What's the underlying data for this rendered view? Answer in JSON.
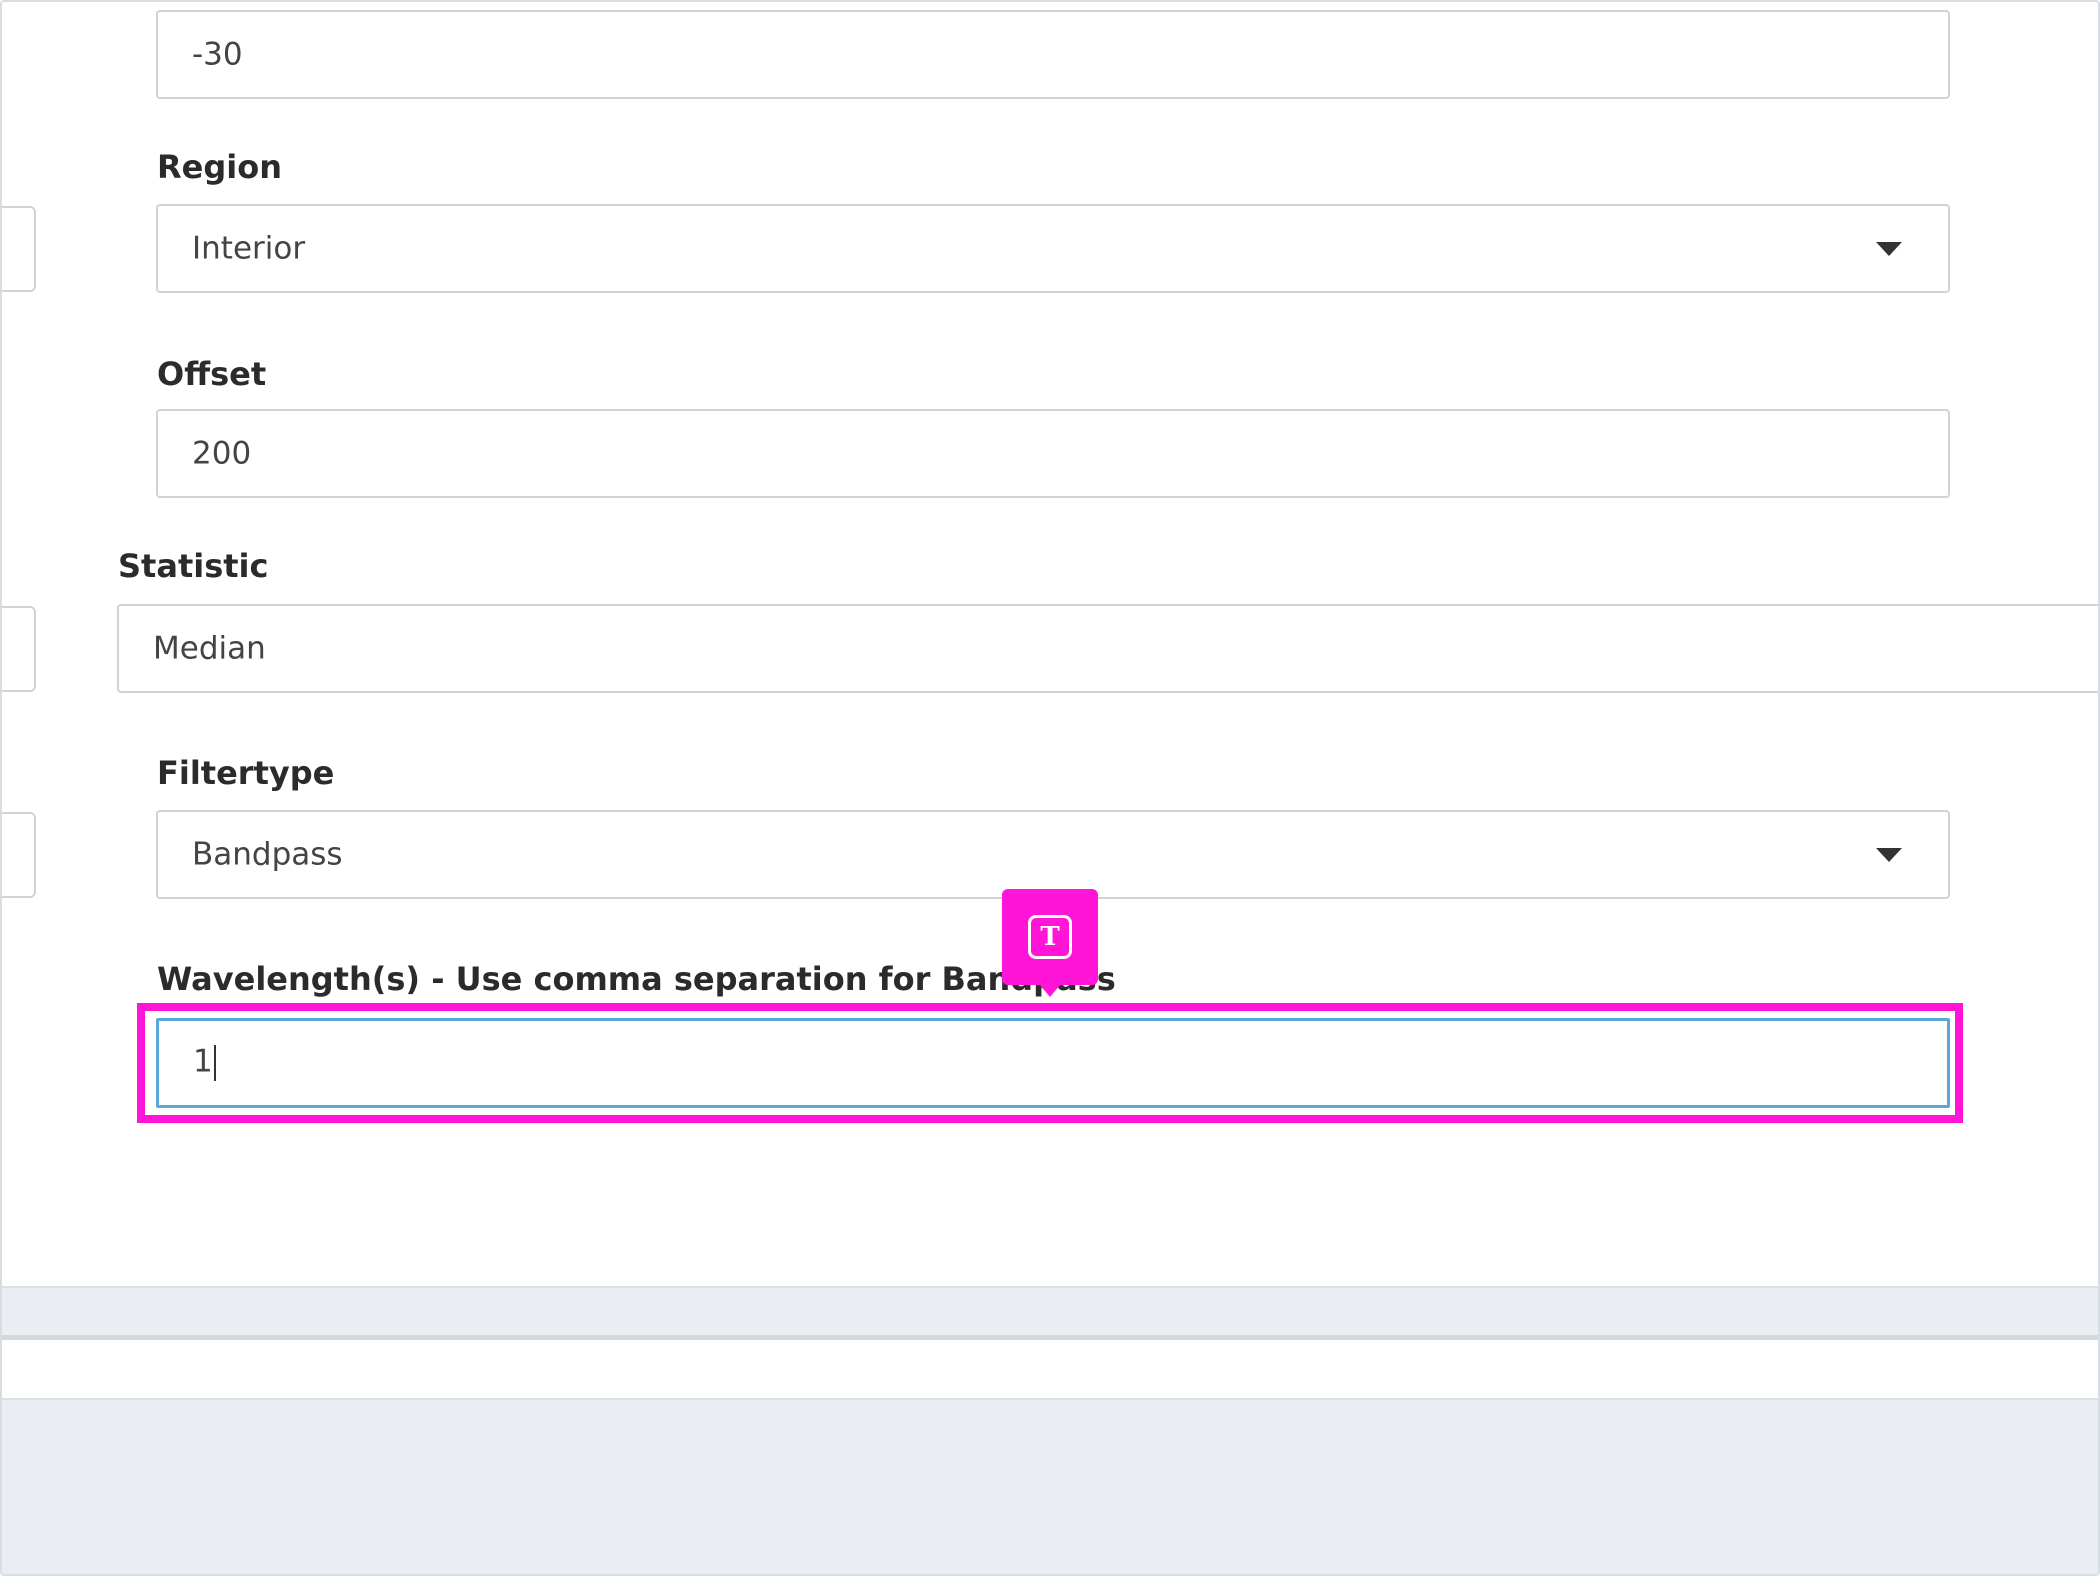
{
  "form": {
    "top_field_value": "-30",
    "region": {
      "label": "Region",
      "value": "Interior"
    },
    "offset": {
      "label": "Offset",
      "value": "200"
    },
    "statistic": {
      "label": "Statistic",
      "value": "Median"
    },
    "filtertype": {
      "label": "Filtertype",
      "value": "Bandpass"
    },
    "wavelength": {
      "label": "Wavelength(s) - Use comma separation for Bandpass",
      "value": "1"
    }
  },
  "overlay": {
    "tag_glyph": "T",
    "tag_icon": "text-input-icon",
    "highlight_color": "#ff14d8"
  }
}
